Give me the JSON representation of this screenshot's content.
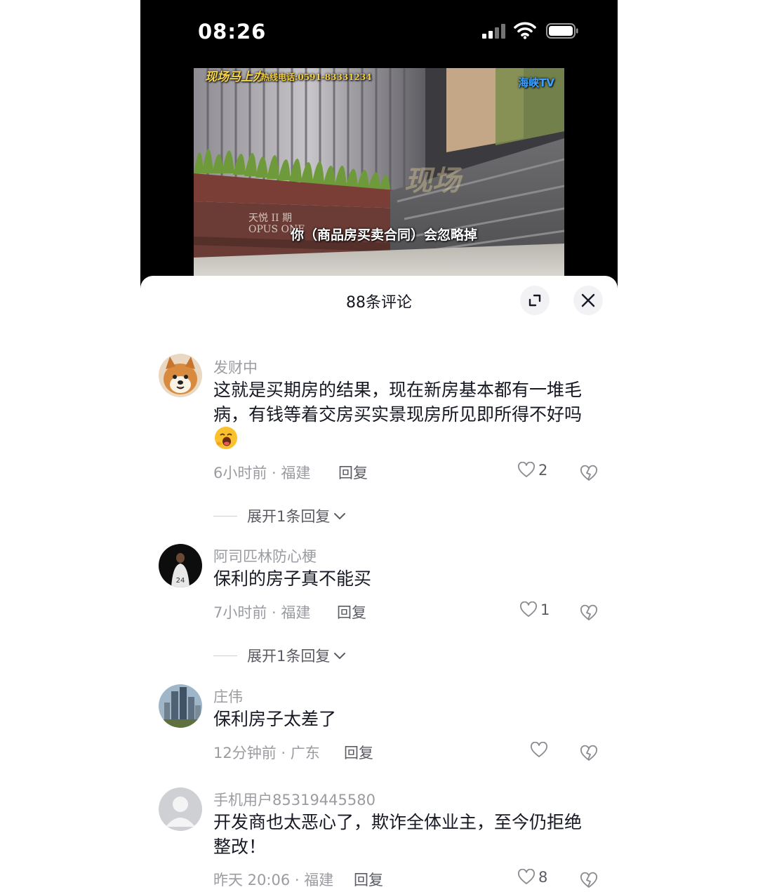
{
  "status_bar": {
    "time": "08:26"
  },
  "video": {
    "logo": "现场马上办",
    "hotline": "热线电话:0591-83331234",
    "channel": "海峡TV",
    "watermark": "现场",
    "sign": "天悦 II 期\nOPUS ONE",
    "subtitle": "你（商品房买卖合同）会忽略掉"
  },
  "sheet": {
    "title": "88条评论"
  },
  "comments": [
    {
      "author": "发财中",
      "text": "这就是买期房的结果，现在新房基本都有一堆毛病，有钱等着交房买实景现房所见即所得不好吗",
      "emoji": "yawning-face-emoji",
      "meta": "6小时前 · 福建",
      "reply": "回复",
      "likes": "2",
      "expand": "展开1条回复"
    },
    {
      "author": "阿司匹林防心梗",
      "text": "保利的房子真不能买",
      "meta": "7小时前 · 福建",
      "reply": "回复",
      "likes": "1",
      "expand": "展开1条回复"
    },
    {
      "author": "庄伟",
      "text": "保利房子太差了",
      "meta": "12分钟前 · 广东",
      "reply": "回复",
      "likes": ""
    },
    {
      "author": "手机用户85319445580",
      "text": "开发商也太恶心了，欺诈全体业主，至今仍拒绝整改！",
      "meta": "昨天 20:06 · 福建",
      "reply": "回复",
      "likes": "8"
    }
  ],
  "colors": {
    "text_primary": "#161823",
    "text_secondary": "#9b9ca1",
    "button_bg": "#f2f2f4"
  }
}
